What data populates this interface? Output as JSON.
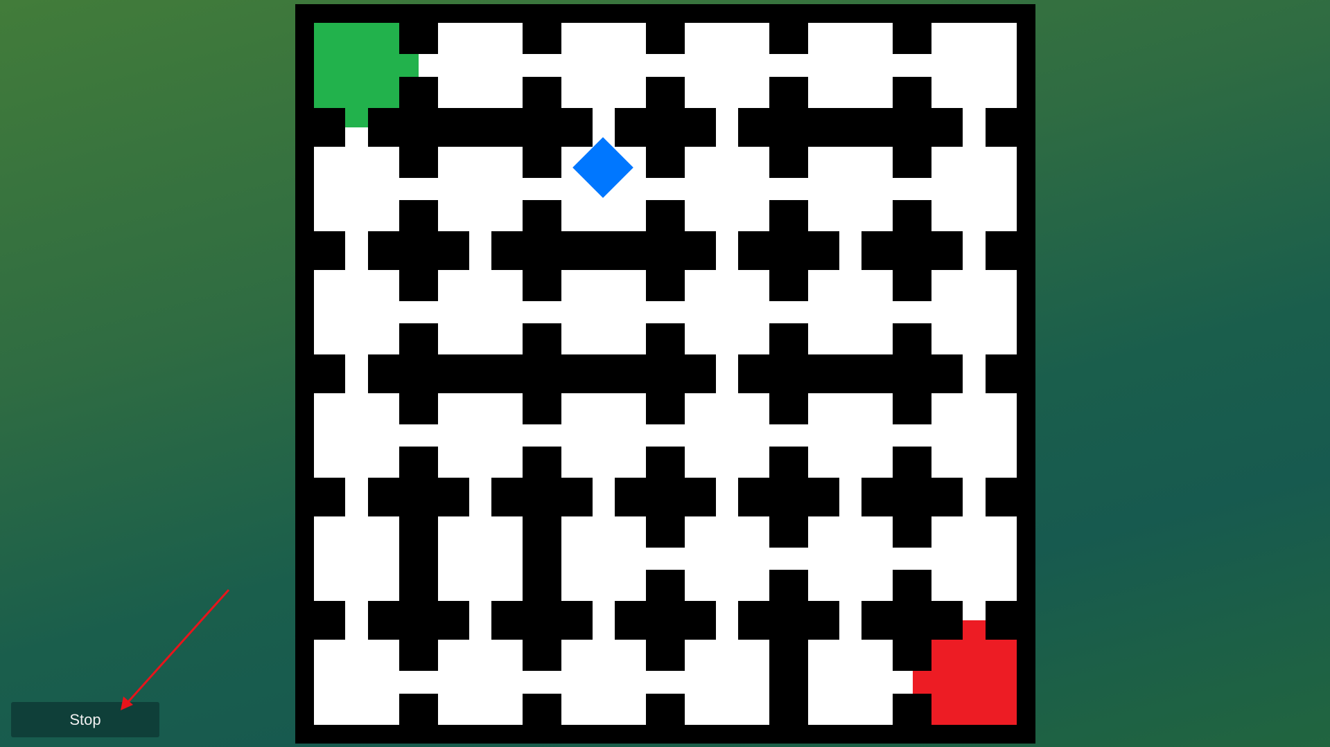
{
  "controls": {
    "stop_label": "Stop"
  },
  "colors": {
    "start": "#22b24c",
    "goal": "#ed1c24",
    "player": "#0077ff",
    "wall": "#000000",
    "floor": "#ffffff"
  },
  "maze": {
    "cols": 6,
    "rows": 6,
    "start_cell": [
      0,
      0
    ],
    "goal_cell": [
      5,
      5
    ],
    "player_cell_note": "between cell (1,0)/(2,0) passage",
    "horizontal_wall_rows": [
      [
        false,
        true,
        false,
        false,
        true,
        false
      ],
      [
        false,
        false,
        true,
        false,
        false,
        false
      ],
      [
        false,
        true,
        true,
        false,
        true,
        false
      ],
      [
        false,
        false,
        false,
        false,
        false,
        false
      ],
      [
        false,
        false,
        false,
        false,
        false,
        false
      ]
    ],
    "vertical_wall_rows": [
      [
        false,
        false,
        false,
        false,
        false
      ],
      [
        false,
        false,
        false,
        false,
        false
      ],
      [
        false,
        false,
        false,
        false,
        false
      ],
      [
        false,
        false,
        false,
        false,
        false
      ],
      [
        true,
        true,
        false,
        false,
        false
      ],
      [
        false,
        false,
        false,
        true,
        false
      ]
    ]
  },
  "annotation": {
    "arrow": "pointing-to-stop-button",
    "color": "#e8141b"
  }
}
